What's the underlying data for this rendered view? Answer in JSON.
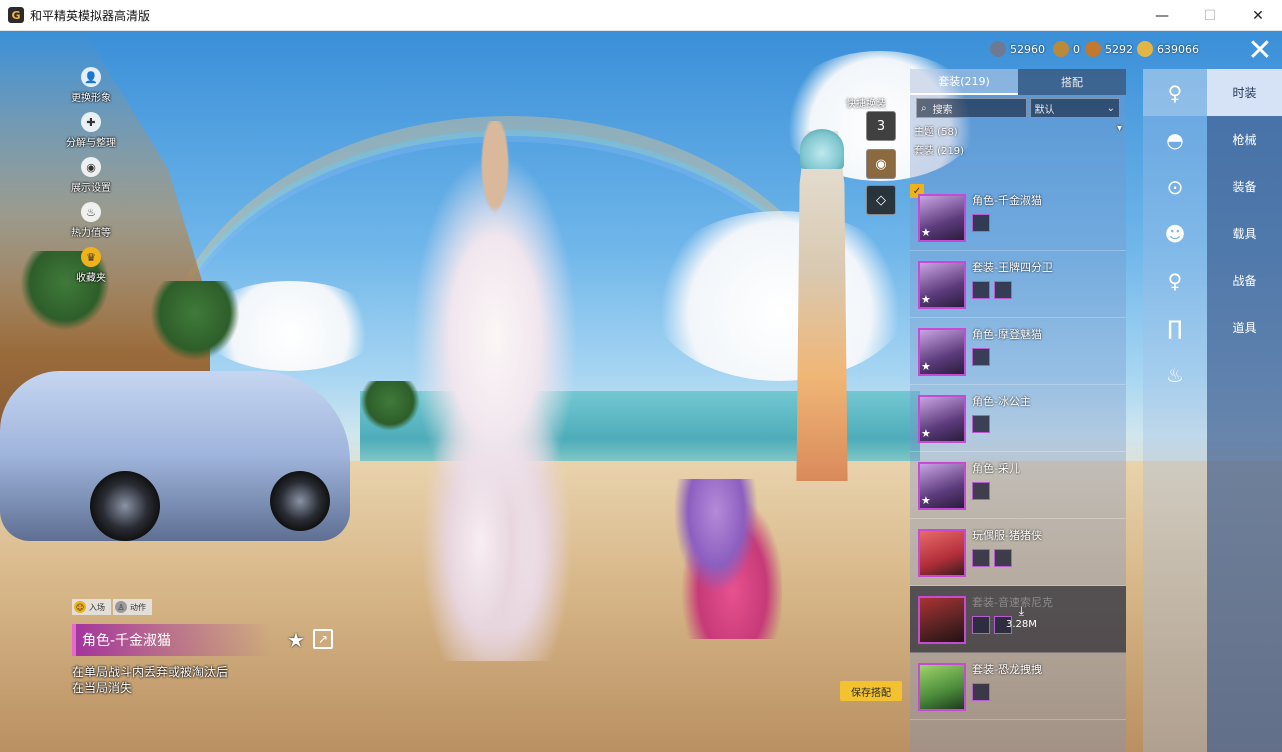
{
  "window": {
    "title": "和平精英模拟器高清版",
    "app_icon_letter": "G",
    "minimize": "—",
    "maximize": "☐",
    "close": "✕"
  },
  "left_menu": [
    {
      "label": "更换形象",
      "icon": "person-icon"
    },
    {
      "label": "分解与整理",
      "icon": "puzzle-icon"
    },
    {
      "label": "展示设置",
      "icon": "eye-icon"
    },
    {
      "label": "热力值等",
      "icon": "fire-icon"
    },
    {
      "label": "收藏夹",
      "icon": "crown-icon"
    }
  ],
  "currencies": [
    {
      "name": "gem",
      "value": "52960",
      "color": "#6d7a92"
    },
    {
      "name": "token",
      "value": "0",
      "color": "#b98a3a"
    },
    {
      "name": "bronze",
      "value": "5292",
      "color": "#c2782e"
    },
    {
      "name": "gold",
      "value": "639066",
      "color": "#e3b545"
    }
  ],
  "quick": {
    "label": "快捷换装",
    "items": [
      {
        "name": "hanger-3",
        "text": "3"
      },
      {
        "name": "emblem",
        "text": "◉"
      },
      {
        "name": "diamond",
        "text": "◇"
      }
    ]
  },
  "panel": {
    "tabs": [
      {
        "label": "套装(219)",
        "active": true
      },
      {
        "label": "搭配",
        "active": false
      }
    ],
    "search_label": "搜索",
    "sort_label": "默认",
    "category_theme": "主题 (58)",
    "category_suits": "套装 (219)",
    "items": [
      {
        "title": "角色-千金淑猫",
        "selected": true,
        "downloading": false,
        "minis": 1
      },
      {
        "title": "套装-王牌四分卫",
        "selected": false,
        "downloading": false,
        "minis": 2
      },
      {
        "title": "角色-摩登魅猫",
        "selected": false,
        "downloading": false,
        "minis": 1
      },
      {
        "title": "角色-冰公主",
        "selected": false,
        "downloading": false,
        "minis": 1
      },
      {
        "title": "角色-采儿",
        "selected": false,
        "downloading": false,
        "minis": 1
      },
      {
        "title": "玩偶服-猪猪侠",
        "selected": false,
        "downloading": false,
        "minis": 2
      },
      {
        "title": "套装-音速索尼克",
        "selected": false,
        "downloading": true,
        "minis": 2,
        "size": "3.28M"
      },
      {
        "title": "套装-恐龙拽拽",
        "selected": false,
        "downloading": false,
        "minis": 1
      }
    ]
  },
  "icon_column": [
    {
      "name": "character-icon",
      "glyph": "♀",
      "active": true
    },
    {
      "name": "cap-icon",
      "glyph": "◓",
      "active": false
    },
    {
      "name": "goggles-icon",
      "glyph": "⊙",
      "active": false
    },
    {
      "name": "mask-icon",
      "glyph": "☻",
      "active": false
    },
    {
      "name": "top-icon",
      "glyph": "♀",
      "active": false
    },
    {
      "name": "pants-icon",
      "glyph": "∏",
      "active": false
    },
    {
      "name": "shoes-icon",
      "glyph": "♨",
      "active": false
    }
  ],
  "categories": [
    {
      "label": "时装",
      "active": true
    },
    {
      "label": "枪械",
      "active": false
    },
    {
      "label": "装备",
      "active": false
    },
    {
      "label": "载具",
      "active": false
    },
    {
      "label": "战备",
      "active": false
    },
    {
      "label": "道具",
      "active": false
    }
  ],
  "info": {
    "tag_entry": "入场",
    "tag_action": "动作",
    "name": "角色-千金淑猫",
    "description": "在单局战斗内丢弃或被淘汰后在当局消失",
    "save_button": "保存搭配"
  }
}
